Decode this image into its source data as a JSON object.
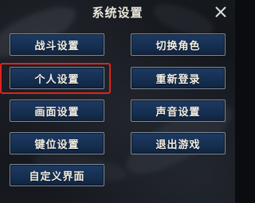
{
  "dialog": {
    "title": "系统设置",
    "close_icon": "close-icon"
  },
  "buttons": {
    "combat_settings": "战斗设置",
    "switch_character": "切换角色",
    "personal_settings": "个人设置",
    "relogin": "重新登录",
    "graphics_settings": "画面设置",
    "sound_settings": "声音设置",
    "key_settings": "键位设置",
    "exit_game": "退出游戏",
    "custom_ui": "自定义界面"
  },
  "highlight": {
    "target": "personal_settings",
    "color": "#e0231c"
  },
  "colors": {
    "button_fill": "#163052",
    "button_border": "#7f8c9c",
    "text": "#f2efe6",
    "background": "#111318"
  }
}
